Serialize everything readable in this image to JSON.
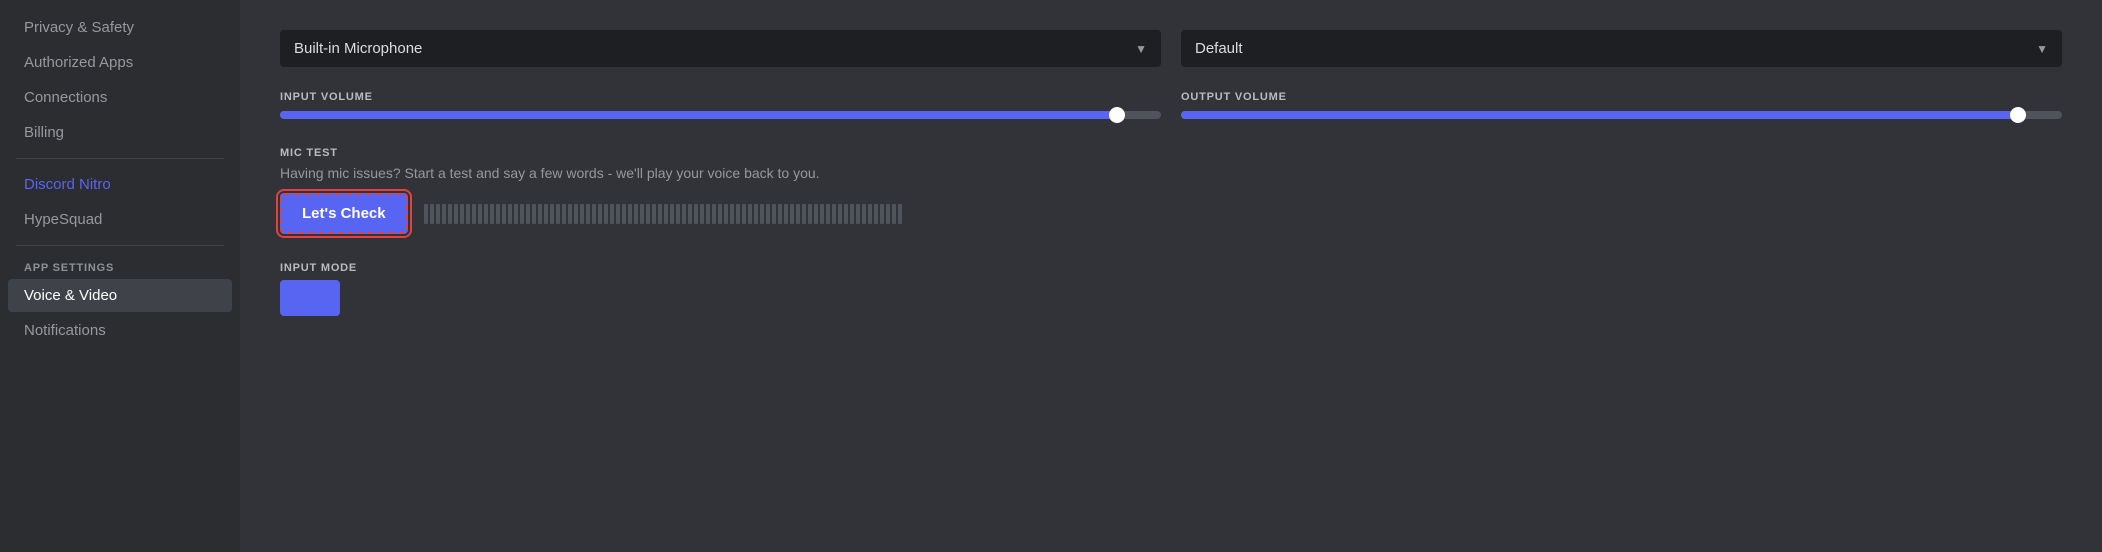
{
  "sidebar": {
    "items_top": [
      {
        "id": "privacy-safety",
        "label": "Privacy & Safety",
        "active": false,
        "accent": false
      },
      {
        "id": "authorized-apps",
        "label": "Authorized Apps",
        "active": false,
        "accent": false
      },
      {
        "id": "connections",
        "label": "Connections",
        "active": false,
        "accent": false
      },
      {
        "id": "billing",
        "label": "Billing",
        "active": false,
        "accent": false
      }
    ],
    "items_nitro": [
      {
        "id": "discord-nitro",
        "label": "Discord Nitro",
        "active": false,
        "accent": true
      },
      {
        "id": "hypesquad",
        "label": "HypeSquad",
        "active": false,
        "accent": false
      }
    ],
    "app_settings_label": "APP SETTINGS",
    "items_app": [
      {
        "id": "voice-video",
        "label": "Voice & Video",
        "active": true,
        "accent": false
      },
      {
        "id": "notifications",
        "label": "Notifications",
        "active": false,
        "accent": false
      }
    ]
  },
  "main": {
    "microphone_dropdown": {
      "value": "Built-in Microphone",
      "arrow": "▼"
    },
    "output_dropdown": {
      "value": "Default",
      "arrow": "▼"
    },
    "input_volume_label": "INPUT VOLUME",
    "output_volume_label": "OUTPUT VOLUME",
    "input_volume_pct": 95,
    "output_volume_pct": 95,
    "mic_test_label": "MIC TEST",
    "mic_test_desc": "Having mic issues? Start a test and say a few words - we'll play your voice back to you.",
    "lets_check_label": "Let's Check",
    "input_mode_label": "INPUT MODE",
    "mic_bars_count": 80
  }
}
